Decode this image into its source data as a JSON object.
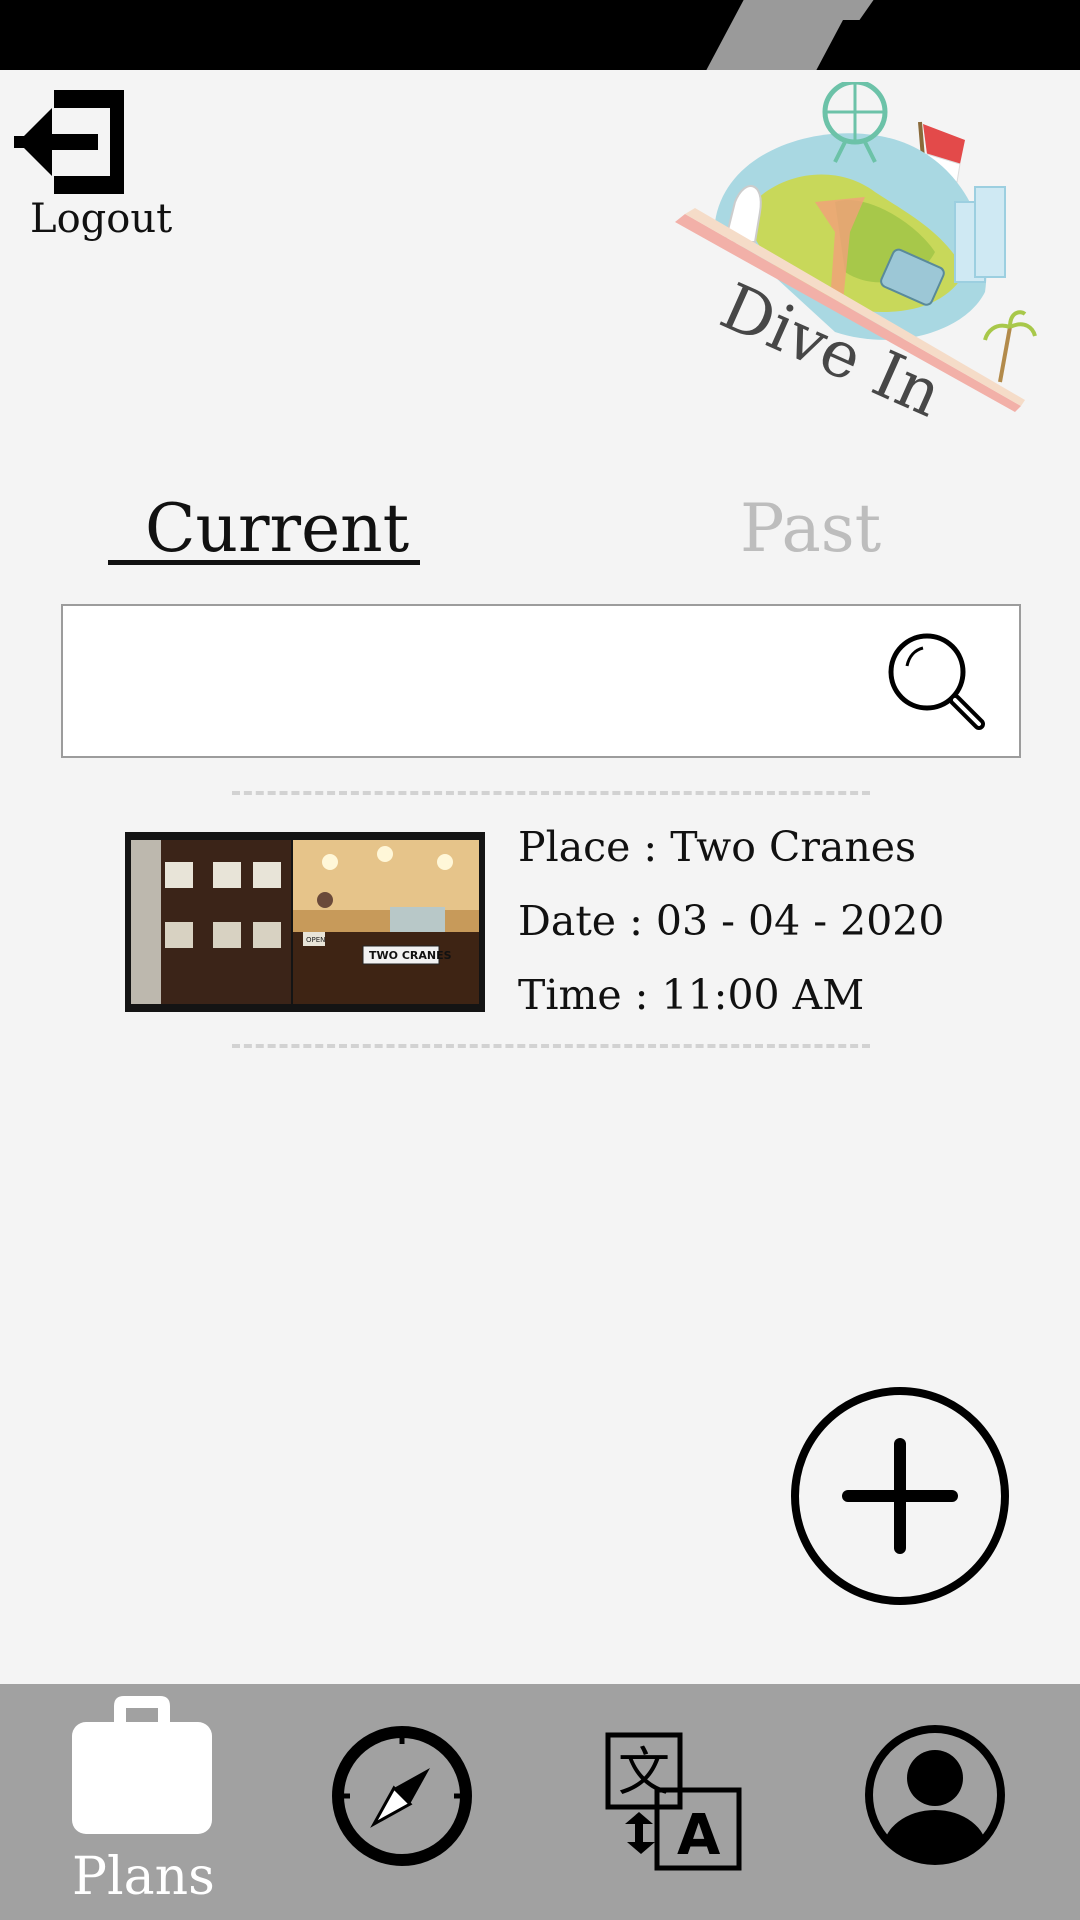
{
  "header": {
    "logout_label": "Logout",
    "logo_text": "Dive In"
  },
  "tabs": [
    {
      "label": "Current",
      "active": true
    },
    {
      "label": "Past",
      "active": false
    }
  ],
  "search": {
    "value": "",
    "placeholder": ""
  },
  "plans": [
    {
      "place": "Place : Two Cranes",
      "date": "Date  : 03 - 04 - 2020",
      "time": "Time : 11:00 AM",
      "photo_sign": "TWO CRANES",
      "photo_open_sign": "OPEN"
    }
  ],
  "bottom_nav": {
    "items": [
      {
        "label": "Plans",
        "icon": "suitcase-icon",
        "active": true
      },
      {
        "label": "",
        "icon": "compass-icon",
        "active": false
      },
      {
        "label": "",
        "icon": "translate-icon",
        "active": false
      },
      {
        "label": "",
        "icon": "profile-icon",
        "active": false
      }
    ]
  },
  "colors": {
    "background": "#f4f4f4",
    "status_bar": "#000000",
    "nav_bar": "#a1a1a1",
    "inactive_tab": "#bdbdbd",
    "active_nav_label": "#ffffff"
  }
}
